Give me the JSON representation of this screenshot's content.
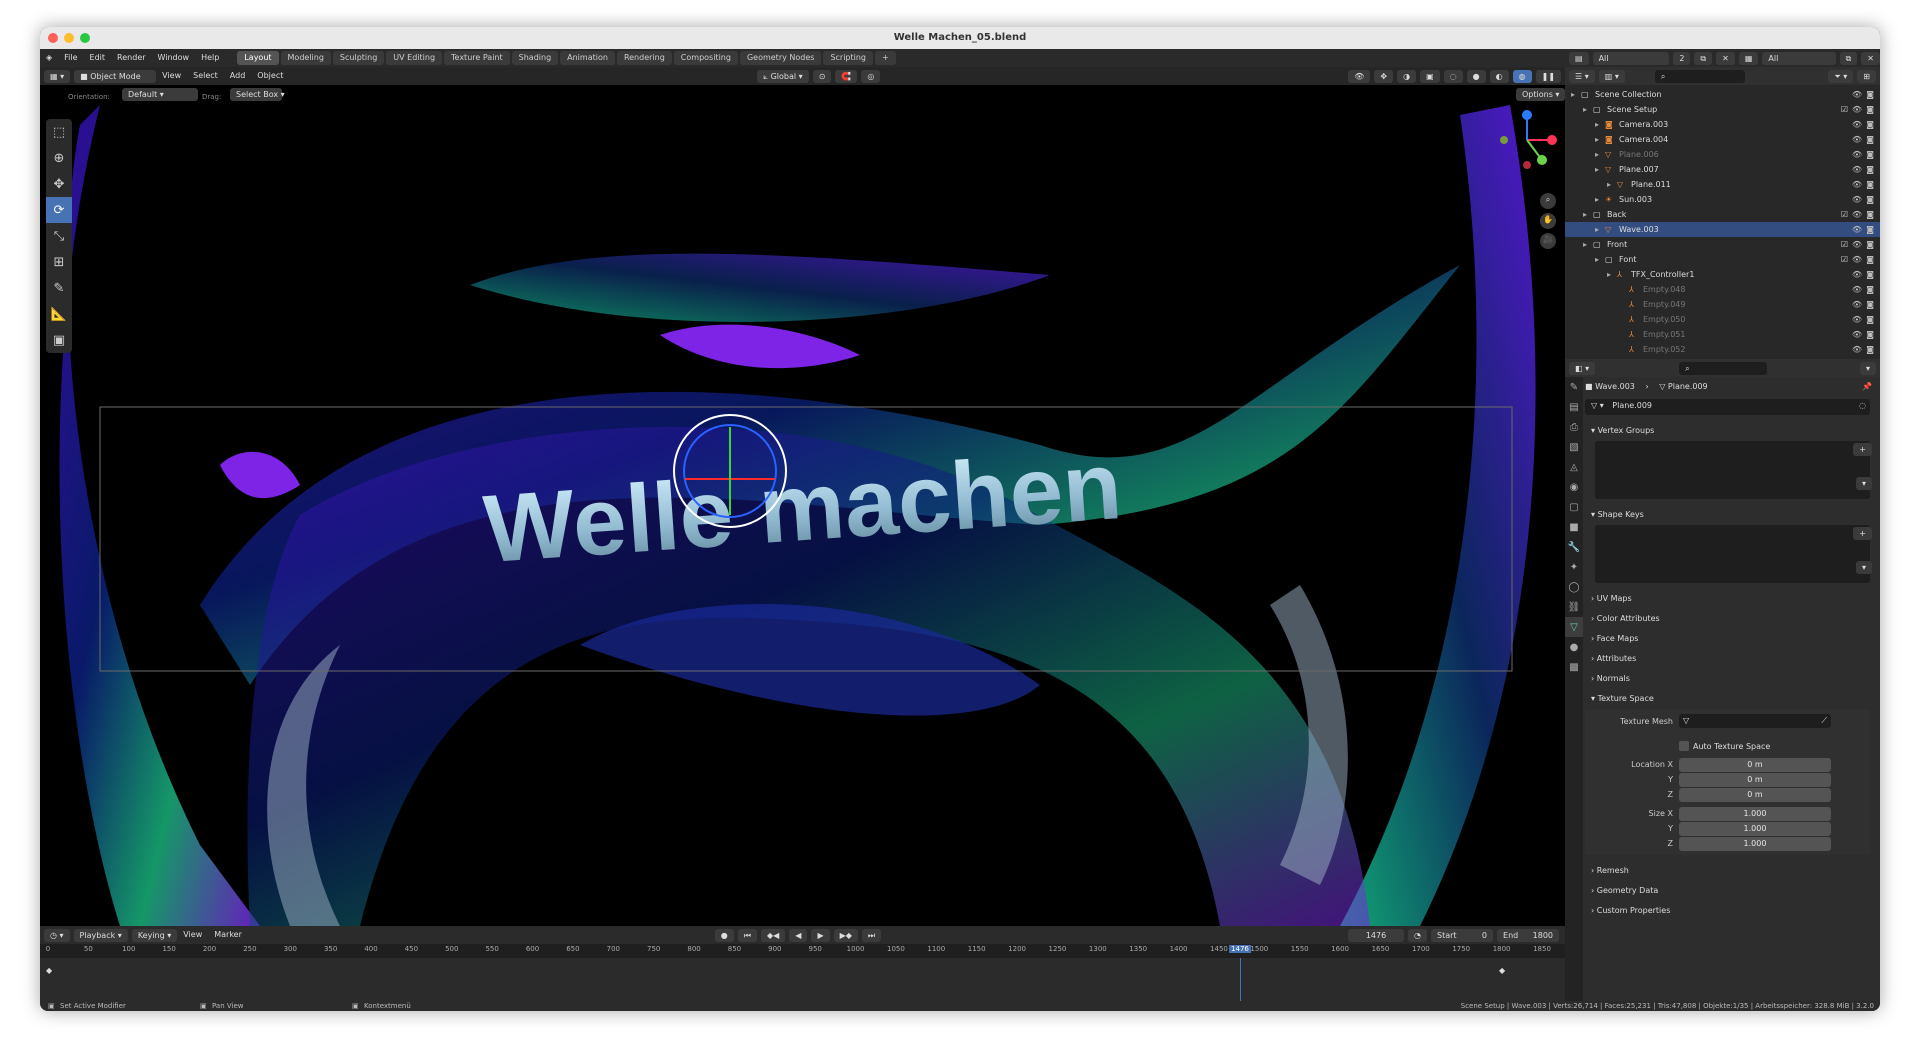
{
  "window": {
    "title": "Welle Machen_05.blend"
  },
  "menu": [
    "File",
    "Edit",
    "Render",
    "Window",
    "Help"
  ],
  "workspaces": [
    "Layout",
    "Modeling",
    "Sculpting",
    "UV Editing",
    "Texture Paint",
    "Shading",
    "Animation",
    "Rendering",
    "Compositing",
    "Geometry Nodes",
    "Scripting"
  ],
  "view_header": {
    "mode": "Object Mode",
    "view": "View",
    "select": "Select",
    "add": "Add",
    "object": "Object",
    "orientation_label": "Orientation:",
    "orientation": "Default",
    "drag_label": "Drag:",
    "drag": "Select Box",
    "transform": "Global",
    "options": "Options"
  },
  "scene_header": {
    "scene": "All",
    "scene_count": "2",
    "view_layer": "All"
  },
  "tools": [
    "select-box-icon",
    "cursor-icon",
    "move-icon",
    "rotate-icon",
    "scale-icon",
    "transform-icon",
    "annotate-icon",
    "measure-icon",
    "add-cube-icon"
  ],
  "viewport": {
    "text": "Welle machen"
  },
  "timeline": {
    "playback": "Playback",
    "keying": "Keying",
    "view": "View",
    "marker": "Marker",
    "current_frame": "1476",
    "start_label": "Start",
    "start": "0",
    "end_label": "End",
    "end": "1800",
    "ticks": [
      "0",
      "50",
      "100",
      "150",
      "200",
      "250",
      "300",
      "350",
      "400",
      "450",
      "500",
      "550",
      "600",
      "650",
      "700",
      "750",
      "800",
      "850",
      "900",
      "950",
      "1000",
      "1050",
      "1100",
      "1150",
      "1200",
      "1250",
      "1300",
      "1350",
      "1400",
      "1450",
      "1476",
      "1500",
      "1550",
      "1600",
      "1650",
      "1700",
      "1750",
      "1800",
      "1850"
    ]
  },
  "statusbar": {
    "left": "Set Active Modifier",
    "mid": "Pan View",
    "right_hint": "Kontextmenü",
    "stats": "Scene Setup | Wave.003 | Verts:26,714 | Faces:25,231 | Tris:47,808 | Objekte:1/35 | Arbeitsspeicher: 328.8 MiB | 3.2.0"
  },
  "outliner": {
    "rows": [
      {
        "label": "Scene Collection",
        "depth": 0,
        "icon": "collection-icon"
      },
      {
        "label": "Scene Setup",
        "depth": 1,
        "icon": "collection-icon",
        "checked": true
      },
      {
        "label": "Camera.003",
        "depth": 2,
        "icon": "camera-icon"
      },
      {
        "label": "Camera.004",
        "depth": 2,
        "icon": "camera-icon"
      },
      {
        "label": "Plane.006",
        "depth": 2,
        "icon": "mesh-icon",
        "dim": true
      },
      {
        "label": "Plane.007",
        "depth": 2,
        "icon": "mesh-icon"
      },
      {
        "label": "Plane.011",
        "depth": 3,
        "icon": "mesh-icon"
      },
      {
        "label": "Sun.003",
        "depth": 2,
        "icon": "light-icon"
      },
      {
        "label": "Back",
        "depth": 1,
        "icon": "collection-icon",
        "checked": true
      },
      {
        "label": "Wave.003",
        "depth": 2,
        "icon": "mesh-icon",
        "selected": true
      },
      {
        "label": "Front",
        "depth": 1,
        "icon": "collection-icon",
        "checked": true
      },
      {
        "label": "Font",
        "depth": 2,
        "icon": "collection-icon",
        "checked": true
      },
      {
        "label": "TFX_Controller1",
        "depth": 3,
        "icon": "empty-icon"
      },
      {
        "label": "Empty.048",
        "depth": 4,
        "icon": "empty-icon",
        "dim": true
      },
      {
        "label": "Empty.049",
        "depth": 4,
        "icon": "empty-icon",
        "dim": true
      },
      {
        "label": "Empty.050",
        "depth": 4,
        "icon": "empty-icon",
        "dim": true
      },
      {
        "label": "Empty.051",
        "depth": 4,
        "icon": "empty-icon",
        "dim": true
      },
      {
        "label": "Empty.052",
        "depth": 4,
        "icon": "empty-icon",
        "dim": true
      }
    ]
  },
  "properties": {
    "breadcrumb": {
      "object": "Wave.003",
      "data": "Plane.009"
    },
    "datablock": "Plane.009",
    "panels": {
      "vertex_groups": "Vertex Groups",
      "shape_keys": "Shape Keys",
      "uv_maps": "UV Maps",
      "color_attributes": "Color Attributes",
      "face_maps": "Face Maps",
      "attributes": "Attributes",
      "normals": "Normals",
      "texture_space": "Texture Space",
      "remesh": "Remesh",
      "geometry_data": "Geometry Data",
      "custom_properties": "Custom Properties"
    },
    "texture_space": {
      "texture_mesh_label": "Texture Mesh",
      "auto_label": "Auto Texture Space",
      "location_x_label": "Location X",
      "y_label": "Y",
      "z_label": "Z",
      "loc_x": "0 m",
      "loc_y": "0 m",
      "loc_z": "0 m",
      "size_x_label": "Size X",
      "size_x": "1.000",
      "size_y": "1.000",
      "size_z": "1.000"
    }
  }
}
